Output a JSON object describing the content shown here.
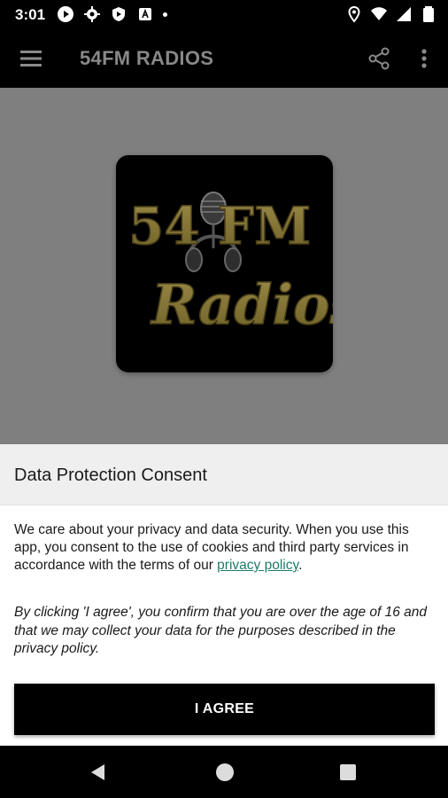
{
  "status_bar": {
    "time": "3:01",
    "left_icons": [
      "play-icon",
      "settings-icon",
      "shield-icon",
      "font-icon",
      "dot"
    ],
    "right_icons": [
      "location-icon",
      "wifi-icon",
      "signal-icon",
      "battery-icon"
    ]
  },
  "app_bar": {
    "title": "54FM RADIOS",
    "menu_icon": "menu-icon",
    "share_icon": "share-icon",
    "more_icon": "more-vert-icon"
  },
  "logo": {
    "line1": "54 FM",
    "line2": "Radios",
    "color": "#8a7a3a"
  },
  "consent": {
    "title": "Data Protection Consent",
    "text_before_link": "We care about your privacy and data security. When you use this app, you consent to the use of cookies and third party services in accordance with the terms of our ",
    "link_text": "privacy policy",
    "text_after_link": ".",
    "note": "By clicking 'I agree', you confirm that you are over the age of 16 and that we may collect your data for the purposes described in the privacy policy.",
    "button_label": "I AGREE"
  },
  "nav_bar": {
    "icons": [
      "back-icon",
      "home-icon",
      "recents-icon"
    ]
  },
  "colors": {
    "link": "#1e7c6a",
    "overlay": "#7f7f7f",
    "header": "#efefef"
  }
}
